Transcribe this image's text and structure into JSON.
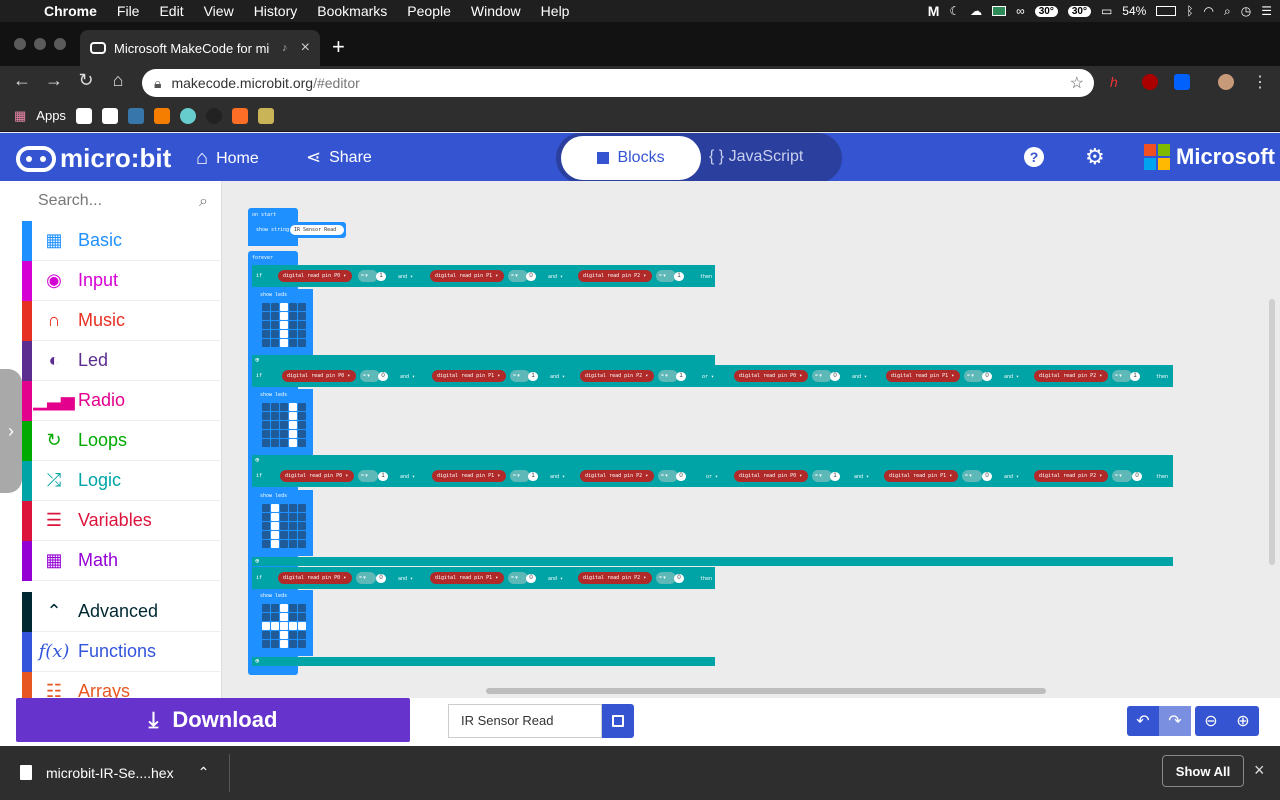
{
  "menubar": {
    "app": "Chrome",
    "items": [
      "File",
      "Edit",
      "View",
      "History",
      "Bookmarks",
      "People",
      "Window",
      "Help"
    ],
    "temp1": "30°",
    "temp2": "30°",
    "battery": "54%"
  },
  "tab": {
    "title": "Microsoft MakeCode for mi"
  },
  "address": {
    "url_host": "makecode.microbit.org",
    "url_path": "/#editor"
  },
  "bookmarks": {
    "apps_label": "Apps"
  },
  "header": {
    "brand": "micro:bit",
    "home_label": "Home",
    "share_label": "Share",
    "blocks_label": "Blocks",
    "js_label": "JavaScript",
    "ms_label": "Microsoft"
  },
  "toolbox": {
    "search_placeholder": "Search...",
    "categories": [
      {
        "label": "Basic",
        "color": "#1e90ff"
      },
      {
        "label": "Input",
        "color": "#d400d4"
      },
      {
        "label": "Music",
        "color": "#e63022"
      },
      {
        "label": "Led",
        "color": "#5c2d91"
      },
      {
        "label": "Radio",
        "color": "#e3008c"
      },
      {
        "label": "Loops",
        "color": "#00aa00"
      },
      {
        "label": "Logic",
        "color": "#00a4a6"
      },
      {
        "label": "Variables",
        "color": "#dc143c"
      },
      {
        "label": "Math",
        "color": "#9400d3"
      },
      {
        "label": "Advanced",
        "color": "#002833"
      },
      {
        "label": "Functions",
        "color": "#3455db"
      },
      {
        "label": "Arrays",
        "color": "#e65722"
      }
    ]
  },
  "workspace": {
    "on_start": "on start",
    "show_string": "show string",
    "string_value": "IR Sensor Read",
    "forever": "forever",
    "if_label": "if",
    "then_label": "then",
    "and_label": "and ▾",
    "or_label": "or ▾",
    "eq_label": "= ▾",
    "show_leds": "show leds",
    "pin_p0": "digital read pin  P0 ▾",
    "pin_p1": "digital read pin  P1 ▾",
    "pin_p2": "digital read pin  P2 ▾",
    "plus": "⊕",
    "rows": [
      {
        "vals": [
          "1",
          "0",
          "1"
        ],
        "leds": [
          0,
          0,
          1,
          0,
          0,
          0,
          0,
          1,
          0,
          0,
          0,
          0,
          1,
          0,
          0,
          0,
          0,
          1,
          0,
          0,
          0,
          0,
          1,
          0,
          0
        ]
      },
      {
        "vals": [
          "0",
          "1",
          "1",
          "0",
          "0",
          "1"
        ],
        "leds": [
          0,
          0,
          0,
          1,
          0,
          0,
          0,
          0,
          1,
          0,
          0,
          0,
          0,
          1,
          0,
          0,
          0,
          0,
          1,
          0,
          0,
          0,
          0,
          1,
          0
        ]
      },
      {
        "vals": [
          "1",
          "1",
          "0",
          "1",
          "0",
          "0"
        ],
        "leds": [
          0,
          1,
          0,
          0,
          0,
          0,
          1,
          0,
          0,
          0,
          0,
          1,
          0,
          0,
          0,
          0,
          1,
          0,
          0,
          0,
          0,
          1,
          0,
          0,
          0
        ]
      },
      {
        "vals": [
          "0",
          "0",
          "0"
        ],
        "leds": [
          0,
          0,
          1,
          0,
          0,
          0,
          0,
          1,
          0,
          0,
          1,
          1,
          1,
          1,
          1,
          0,
          0,
          1,
          0,
          0,
          0,
          0,
          1,
          0,
          0
        ]
      }
    ]
  },
  "editor": {
    "download_label": "Download",
    "project_name": "IR Sensor Read"
  },
  "shelf": {
    "file_name": "microbit-IR-Se....hex",
    "show_all": "Show All"
  }
}
